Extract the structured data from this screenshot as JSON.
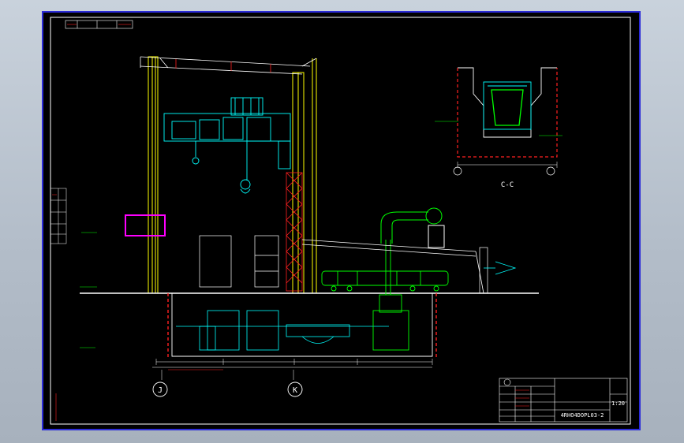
{
  "section_label": "C-C",
  "axis_bubbles": [
    "J",
    "K"
  ],
  "scale_text": "1:20",
  "drawing_number": "4RHO4DOPL03-2",
  "colors": {
    "background": "#000000",
    "frame": "#2b2bd8",
    "structure": "#ffffff",
    "crane": "#00ffff",
    "columns": "#ffff00",
    "tank": "#00ff00",
    "dimension": "#ff2020",
    "highlight_box": "#ff00ff"
  }
}
